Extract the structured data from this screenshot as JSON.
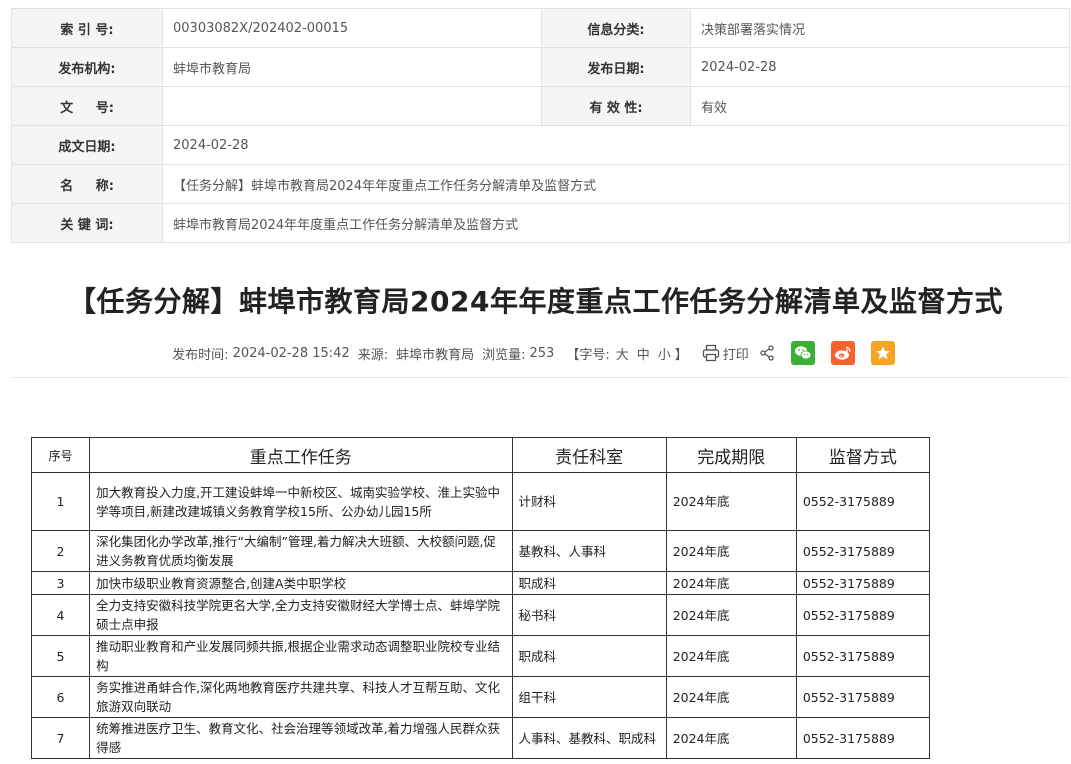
{
  "meta": {
    "index_label": "索 引 号:",
    "index_value": "00303082X/202402-00015",
    "category_label": "信息分类:",
    "category_value": "决策部署落实情况",
    "publisher_label": "发布机构:",
    "publisher_value": "蚌埠市教育局",
    "pubdate_label": "发布日期:",
    "pubdate_value": "2024-02-28",
    "docno_label": "文     号:",
    "docno_value": "",
    "validity_label": "有 效 性:",
    "validity_value": "有效",
    "created_label": "成文日期:",
    "created_value": "2024-02-28",
    "name_label": "名     称:",
    "name_value": "【任务分解】蚌埠市教育局2024年年度重点工作任务分解清单及监督方式",
    "keywords_label": "关 键 词:",
    "keywords_value": "蚌埠市教育局2024年年度重点工作任务分解清单及监督方式"
  },
  "article": {
    "title": "【任务分解】蚌埠市教育局2024年年度重点工作任务分解清单及监督方式",
    "time_label": "发布时间:",
    "time_value": "2024-02-28 15:42",
    "source_label": "来源:",
    "source_value": "蚌埠市教育局",
    "views_label": "浏览量:",
    "views_value": "253",
    "fontsize_open": "【字号:",
    "fontsize_large": "大",
    "fontsize_medium": "中",
    "fontsize_small": "小",
    "fontsize_close": "】",
    "print_label": "打印"
  },
  "colors": {
    "wechat": "#3cb034",
    "weibo": "#f4632a",
    "favorite": "#f6a424"
  },
  "icons": [
    "print-icon",
    "share-icon",
    "wechat-icon",
    "weibo-icon",
    "favorite-icon"
  ],
  "task_table": {
    "headers": [
      "序号",
      "重点工作任务",
      "责任科室",
      "完成期限",
      "监督方式"
    ],
    "rows": [
      {
        "no": "1",
        "task": "加大教育投入力度,开工建设蚌埠一中新校区、城南实验学校、淮上实验中学等项目,新建改建城镇义务教育学校15所、公办幼儿园15所",
        "dept": "计财科",
        "deadline": "2024年底",
        "supervision": "0552-3175889"
      },
      {
        "no": "2",
        "task": "深化集团化办学改革,推行“大编制”管理,着力解决大班额、大校额问题,促进义务教育优质均衡发展",
        "dept": "基教科、人事科",
        "deadline": "2024年底",
        "supervision": "0552-3175889"
      },
      {
        "no": "3",
        "task": "加快市级职业教育资源整合,创建A类中职学校",
        "dept": "职成科",
        "deadline": "2024年底",
        "supervision": "0552-3175889"
      },
      {
        "no": "4",
        "task": "全力支持安徽科技学院更名大学,全力支持安徽财经大学博士点、蚌埠学院硕士点申报",
        "dept": "秘书科",
        "deadline": "2024年底",
        "supervision": "0552-3175889"
      },
      {
        "no": "5",
        "task": "推动职业教育和产业发展同频共振,根据企业需求动态调整职业院校专业结构",
        "dept": "职成科",
        "deadline": "2024年底",
        "supervision": "0552-3175889"
      },
      {
        "no": "6",
        "task": "务实推进甬蚌合作,深化两地教育医疗共建共享、科技人才互帮互助、文化旅游双向联动",
        "dept": "组干科",
        "deadline": "2024年底",
        "supervision": "0552-3175889"
      },
      {
        "no": "7",
        "task": "统筹推进医疗卫生、教育文化、社会治理等领域改革,着力增强人民群众获得感",
        "dept": "人事科、基教科、职成科",
        "deadline": "2024年底",
        "supervision": "0552-3175889"
      }
    ]
  }
}
